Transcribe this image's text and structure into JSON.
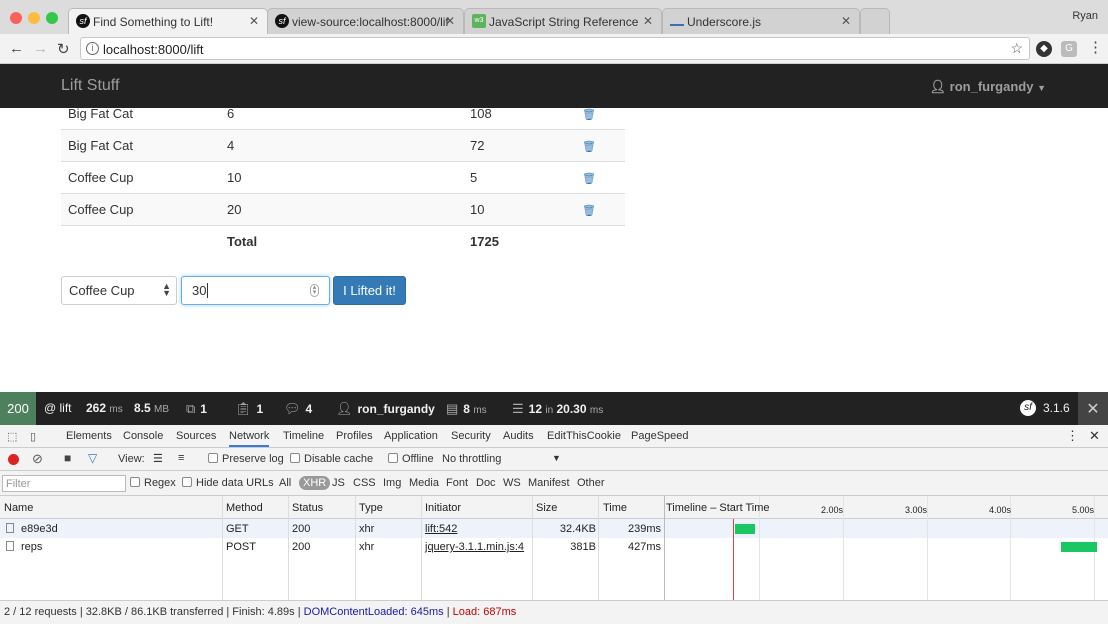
{
  "browser": {
    "tabs": [
      {
        "title": "Find Something to Lift!",
        "icon": "symfony-icon",
        "active": true
      },
      {
        "title": "view-source:localhost:8000/lif",
        "icon": "symfony-icon",
        "active": false
      },
      {
        "title": "JavaScript String Reference",
        "icon": "w3schools-icon",
        "active": false
      },
      {
        "title": "Underscore.js",
        "icon": "underscore-icon",
        "active": false
      }
    ],
    "profile_name": "Ryan",
    "url": "localhost:8000/lift"
  },
  "app": {
    "brand": "Lift Stuff",
    "user": "ron_furgandy"
  },
  "lifts": {
    "rows": [
      {
        "item": "Big Fat Cat",
        "reps": "6",
        "weight": "108"
      },
      {
        "item": "Big Fat Cat",
        "reps": "4",
        "weight": "72"
      },
      {
        "item": "Coffee Cup",
        "reps": "10",
        "weight": "5"
      },
      {
        "item": "Coffee Cup",
        "reps": "20",
        "weight": "10"
      }
    ],
    "total_label": "Total",
    "total_value": "1725"
  },
  "form": {
    "selected_item": "Coffee Cup",
    "reps_value": "30",
    "submit_label": "I Lifted it!"
  },
  "sf_toolbar": {
    "status": "200",
    "route": "@ lift",
    "time_value": "262",
    "time_unit": "ms",
    "memory_value": "8.5",
    "memory_unit": "MB",
    "forms_count": "1",
    "logs_count": "1",
    "messages_count": "4",
    "user": "ron_furgandy",
    "twig_value": "8",
    "twig_unit": "ms",
    "db_queries": "12",
    "db_in": "in",
    "db_time": "20.30",
    "db_unit": "ms",
    "version": "3.1.6"
  },
  "devtools": {
    "panels": [
      "Elements",
      "Console",
      "Sources",
      "Network",
      "Timeline",
      "Profiles",
      "Application",
      "Security",
      "Audits",
      "EditThisCookie",
      "PageSpeed"
    ],
    "active_panel": "Network",
    "toolbar": {
      "view_label": "View:",
      "preserve_log": "Preserve log",
      "disable_cache": "Disable cache",
      "offline": "Offline",
      "throttling": "No throttling"
    },
    "filter": {
      "placeholder": "Filter",
      "regex": "Regex",
      "hide_data_urls": "Hide data URLs",
      "types": [
        "All",
        "XHR",
        "JS",
        "CSS",
        "Img",
        "Media",
        "Font",
        "Doc",
        "WS",
        "Manifest",
        "Other"
      ],
      "selected_type": "XHR"
    },
    "columns": [
      "Name",
      "Method",
      "Status",
      "Type",
      "Initiator",
      "Size",
      "Time",
      "Timeline – Start Time"
    ],
    "timeline_ticks": [
      "2.00s",
      "3.00s",
      "4.00s",
      "5.00s"
    ],
    "requests": [
      {
        "name": "e89e3d",
        "method": "GET",
        "status": "200",
        "type": "xhr",
        "initiator": "lift:542",
        "size": "32.4KB",
        "time": "239ms"
      },
      {
        "name": "reps",
        "method": "POST",
        "status": "200",
        "type": "xhr",
        "initiator": "jquery-3.1.1.min.js:4",
        "size": "381B",
        "time": "427ms"
      }
    ],
    "status_bar": {
      "summary": "2 / 12 requests | 32.8KB / 86.1KB transferred | Finish: 4.89s |",
      "dom_content_loaded": "DOMContentLoaded: 645ms",
      "separator": "|",
      "load": "Load: 687ms"
    }
  },
  "colors": {
    "navbar": "#222222",
    "primary": "#337ab7",
    "sf_status_ok": "#4f805d",
    "timeline_bar": "#1bc763"
  }
}
